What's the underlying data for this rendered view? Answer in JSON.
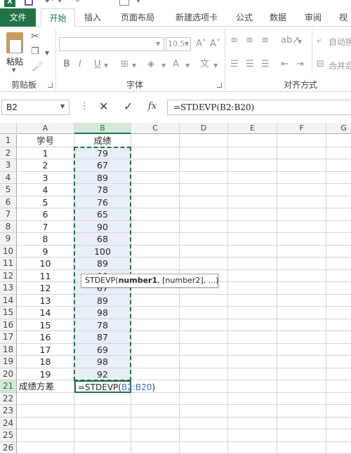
{
  "tabs": [
    {
      "label": "文件"
    },
    {
      "label": "开始"
    },
    {
      "label": "插入"
    },
    {
      "label": "页面布局"
    },
    {
      "label": "新建选项卡"
    },
    {
      "label": "公式"
    },
    {
      "label": "数据"
    },
    {
      "label": "审阅"
    },
    {
      "label": "视"
    }
  ],
  "ribbon": {
    "clipboard": {
      "label": "剪贴板",
      "paste_label": "粘贴"
    },
    "font": {
      "label": "字体",
      "size": "10.5",
      "bold": "B",
      "italic": "I",
      "underline": "U"
    },
    "alignment": {
      "label": "对齐方式",
      "wrap": "自动换",
      "merge": "合并后"
    }
  },
  "formula_bar": {
    "name_box": "B2",
    "fx": "fx",
    "formula": "=STDEVP(B2:B20)"
  },
  "columns": [
    "A",
    "B",
    "C",
    "D",
    "E",
    "F",
    "G"
  ],
  "rows": [
    "1",
    "2",
    "3",
    "4",
    "5",
    "6",
    "7",
    "8",
    "9",
    "10",
    "11",
    "12",
    "13",
    "14",
    "15",
    "16",
    "17",
    "18",
    "19",
    "20",
    "21",
    "22",
    "23",
    "24",
    "25",
    "26"
  ],
  "sheet": {
    "headers": {
      "a": "学号",
      "b": "成绩"
    },
    "data": [
      {
        "id": "1",
        "score": "79"
      },
      {
        "id": "2",
        "score": "67"
      },
      {
        "id": "3",
        "score": "89"
      },
      {
        "id": "4",
        "score": "78"
      },
      {
        "id": "5",
        "score": "76"
      },
      {
        "id": "6",
        "score": "65"
      },
      {
        "id": "7",
        "score": "90"
      },
      {
        "id": "8",
        "score": "68"
      },
      {
        "id": "9",
        "score": "100"
      },
      {
        "id": "10",
        "score": "89"
      },
      {
        "id": "11",
        "score": "90"
      },
      {
        "id": "12",
        "score": "67"
      },
      {
        "id": "13",
        "score": "89"
      },
      {
        "id": "14",
        "score": "98"
      },
      {
        "id": "15",
        "score": "78"
      },
      {
        "id": "16",
        "score": "87"
      },
      {
        "id": "17",
        "score": "69"
      },
      {
        "id": "18",
        "score": "98"
      },
      {
        "id": "19",
        "score": "92"
      }
    ],
    "row21": {
      "label": "成绩方差",
      "formula_prefix": "=STDEVP(",
      "formula_ref": "B2:B20",
      "formula_suffix": ")"
    }
  },
  "tooltip": {
    "fn": "STDEVP(",
    "arg1": "number1",
    "rest": ", [number2], ...)"
  },
  "colors": {
    "accent": "#217346",
    "ref": "#4472c4",
    "highlight": "#e9eff9"
  }
}
